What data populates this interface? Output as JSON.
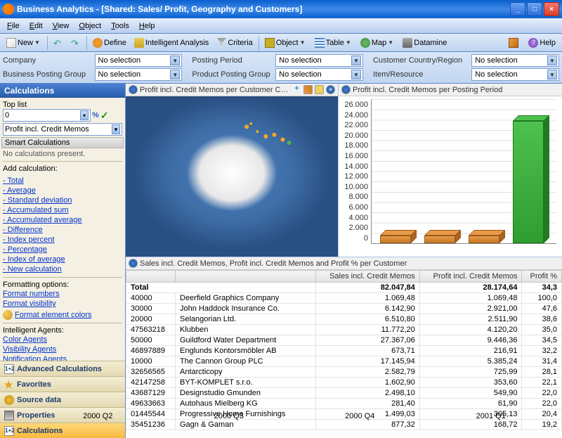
{
  "window": {
    "title": "Business Analytics - [Shared: Sales/ Profit, Geography and Customers]"
  },
  "menu": {
    "file": "File",
    "edit": "Edit",
    "view": "View",
    "object": "Object",
    "tools": "Tools",
    "help": "Help"
  },
  "toolbar": {
    "new": "New",
    "define": "Define",
    "intel": "Intelligent Analysis",
    "criteria": "Criteria",
    "object": "Object",
    "table": "Table",
    "map": "Map",
    "datamine": "Datamine",
    "help": "Help"
  },
  "filters": {
    "company": {
      "label": "Company",
      "value": "No selection"
    },
    "businessPostingGroup": {
      "label": "Business Posting Group",
      "value": "No selection"
    },
    "postingPeriod": {
      "label": "Posting Period",
      "value": "No selection"
    },
    "productPostingGroup": {
      "label": "Product Posting Group",
      "value": "No selection"
    },
    "customerCountry": {
      "label": "Customer Country/Region",
      "value": "No selection"
    },
    "itemResource": {
      "label": "Item/Resource",
      "value": "No selection"
    }
  },
  "sidebar": {
    "calcTitle": "Calculations",
    "topList": "Top list",
    "topValue": "0",
    "percent": "%",
    "check": "✓",
    "measure": "Profit incl. Credit Memos",
    "smart": "Smart Calculations",
    "noCalc": "No calculations present.",
    "add": "Add calculation:",
    "links": [
      "Total",
      "Average",
      "Standard deviation",
      "Accumulated sum",
      "Accumulated average",
      "Difference",
      "Index percent",
      "Percentage",
      "Index of average",
      "New calculation"
    ],
    "fmt": "Formatting options:",
    "fmtLinks": [
      "Format numbers",
      "Format visibility"
    ],
    "fmtColors": "Format element colors",
    "agents": "Intelligent Agents:",
    "agentLinks": [
      "Color Agents",
      "Visibility Agents",
      "Notification Agents"
    ],
    "acc": {
      "adv": "Advanced Calculations",
      "fav": "Favorites",
      "src": "Source data",
      "prop": "Properties",
      "calc": "Calculations"
    }
  },
  "panes": {
    "map": "Profit incl. Credit Memos per Customer Country/Re...",
    "chart": "Profit incl. Credit Memos per Posting Period",
    "table": "Sales incl. Credit Memos, Profit incl. Credit Memos and Profit % per Customer"
  },
  "chart_data": {
    "type": "bar",
    "title": "Profit incl. Credit Memos per Posting Period",
    "categories": [
      "2000 Q2",
      "2000 Q3",
      "2000 Q4",
      "2001 Q1"
    ],
    "values": [
      450,
      460,
      1000,
      26300
    ],
    "colors": [
      "#c87828",
      "#c87828",
      "#c87828",
      "#2e9e2e"
    ],
    "ylim": [
      0,
      28000
    ],
    "yticks": [
      0,
      2000,
      4000,
      6000,
      8000,
      10000,
      12000,
      14000,
      16000,
      18000,
      20000,
      22000,
      24000,
      26000
    ],
    "xlabel": "",
    "ylabel": ""
  },
  "table": {
    "headers": {
      "blank": "",
      "sales": "Sales incl. Credit Memos",
      "profit": "Profit incl. Credit Memos",
      "pct": "Profit %"
    },
    "total": {
      "label": "Total",
      "sales": "82.047,84",
      "profit": "28.174,64",
      "pct": "34,3"
    },
    "rows": [
      {
        "id": "40000",
        "name": "Deerfield Graphics Company",
        "sales": "1.069,48",
        "profit": "1.069,48",
        "pct": "100,0"
      },
      {
        "id": "30000",
        "name": "John Haddock Insurance Co.",
        "sales": "6.142,90",
        "profit": "2.921,00",
        "pct": "47,6"
      },
      {
        "id": "20000",
        "name": "Selangorian Ltd.",
        "sales": "6.510,80",
        "profit": "2.511,90",
        "pct": "38,6"
      },
      {
        "id": "47563218",
        "name": "Klubben",
        "sales": "11.772,20",
        "profit": "4.120,20",
        "pct": "35,0"
      },
      {
        "id": "50000",
        "name": "Guildford Water Department",
        "sales": "27.367,06",
        "profit": "9.446,36",
        "pct": "34,5"
      },
      {
        "id": "46897889",
        "name": "Englunds Kontorsmöbler AB",
        "sales": "673,71",
        "profit": "216,91",
        "pct": "32,2"
      },
      {
        "id": "10000",
        "name": "The Cannon Group PLC",
        "sales": "17.145,94",
        "profit": "5.385,24",
        "pct": "31,4"
      },
      {
        "id": "32656565",
        "name": "Antarcticopy",
        "sales": "2.582,79",
        "profit": "725,99",
        "pct": "28,1"
      },
      {
        "id": "42147258",
        "name": "BYT-KOMPLET s.r.o.",
        "sales": "1.602,90",
        "profit": "353,60",
        "pct": "22,1"
      },
      {
        "id": "43687129",
        "name": "Designstudio Gmunden",
        "sales": "2.498,10",
        "profit": "549,90",
        "pct": "22,0"
      },
      {
        "id": "49633663",
        "name": "Autohaus Mielberg KG",
        "sales": "281,40",
        "profit": "61,90",
        "pct": "22,0"
      },
      {
        "id": "01445544",
        "name": "Progressive Home Furnishings",
        "sales": "1.499,03",
        "profit": "305,13",
        "pct": "20,4"
      },
      {
        "id": "35451236",
        "name": "Gagn & Gaman",
        "sales": "877,32",
        "profit": "168,72",
        "pct": "19,2"
      }
    ]
  }
}
